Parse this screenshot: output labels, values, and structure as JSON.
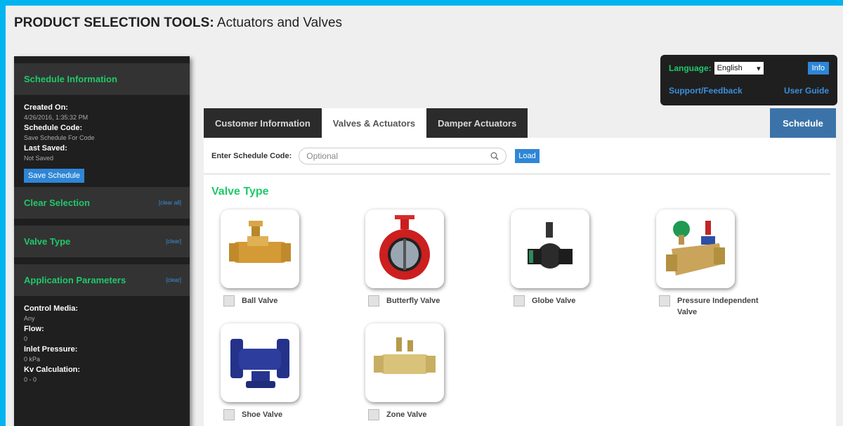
{
  "page": {
    "title_strong": "PRODUCT SELECTION TOOLS:",
    "title_rest": " Actuators and Valves"
  },
  "sidebar": {
    "schedule_info": {
      "heading": "Schedule Information",
      "created_label": "Created On:",
      "created_value": "4/26/2016, 1:35:32 PM",
      "code_label": "Schedule Code:",
      "code_value": "Save Schedule For Code",
      "saved_label": "Last Saved:",
      "saved_value": "Not Saved",
      "save_button": "Save Schedule"
    },
    "clear_selection": {
      "heading": "Clear Selection",
      "clear": "[clear all]"
    },
    "valve_type": {
      "heading": "Valve Type",
      "clear": "[clear]"
    },
    "app_params": {
      "heading": "Application Parameters",
      "clear": "[clear]",
      "control_media_label": "Control Media:",
      "control_media_value": "Any",
      "flow_label": "Flow:",
      "flow_value": "0",
      "inlet_label": "Inlet Pressure:",
      "inlet_value": "0 kPa",
      "kv_label": "Kv Calculation:",
      "kv_value": "0 - 0"
    }
  },
  "topbox": {
    "language_label": "Language:",
    "language_value": "English",
    "info_button": "Info",
    "support_link": "Support/Feedback",
    "guide_link": "User Guide"
  },
  "tabs": {
    "customer": "Customer Information",
    "valves": "Valves & Actuators",
    "damper": "Damper Actuators",
    "schedule": "Schedule"
  },
  "code_entry": {
    "label": "Enter Schedule Code:",
    "placeholder": "Optional",
    "load_button": "Load"
  },
  "valve_section": {
    "title": "Valve Type",
    "items": [
      {
        "label": "Ball Valve"
      },
      {
        "label": "Butterfly Valve"
      },
      {
        "label": "Globe Valve"
      },
      {
        "label": "Pressure Independent Valve"
      },
      {
        "label": "Shoe Valve"
      },
      {
        "label": "Zone Valve"
      }
    ]
  },
  "colors": {
    "accent_green": "#1fc96a",
    "accent_blue": "#2e86d6",
    "frame_blue": "#00b4f0",
    "dark_panel": "#1f1f1f"
  }
}
